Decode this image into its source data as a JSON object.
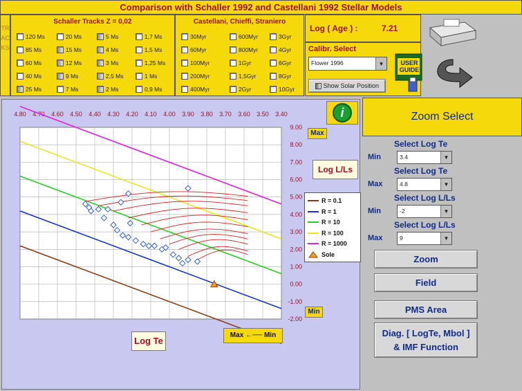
{
  "title": "Comparison with Schaller 1992 and Castellani 1992 Stellar Models",
  "tracks_label": "TRACKS",
  "schaller": {
    "title": "Schaller Tracks  Z = 0,02",
    "items": [
      "120 Ms",
      "20 Ms",
      "5 Ms",
      "1,7 Ms",
      "85 Ms",
      "15 Ms",
      "4 Ms",
      "1,5 Ms",
      "60 Ms",
      "12 Ms",
      "3 Ms",
      "1,25 Ms",
      "40 Ms",
      "9 Ms",
      "2,5 Ms",
      "1 Ms",
      "25 Ms",
      "7 Ms",
      "2 Ms",
      "0,9 Ms"
    ]
  },
  "castellani": {
    "title": "Castellani, Chieffi, Straniero",
    "items": [
      "30Myr",
      "600Myr",
      "3Gyr",
      "60Myr",
      "800Myr",
      "4Gyr",
      "100Myr",
      "1Gyr",
      "6Gyr",
      "200Myr",
      "1,5Gyr",
      "8Gyr",
      "400Myr",
      "2Gyr",
      "10Gyr"
    ]
  },
  "log_age": {
    "label": "Log ( Age ) :",
    "value": "7.21"
  },
  "calibration": {
    "label": "Calibr. Select",
    "value": "Flower 1996",
    "show_solar": "Show Solar Position"
  },
  "user_guide": "USER GUIDE",
  "zoom_select": "Zoom Select",
  "controls": [
    {
      "title": "Select Log Te",
      "side": "Min",
      "value": "3.4"
    },
    {
      "title": "Select Log Te",
      "side": "Max",
      "value": "4.8"
    },
    {
      "title": "Select Log L/Ls",
      "side": "Min",
      "value": "-2"
    },
    {
      "title": "Select Log L/Ls",
      "side": "Max",
      "value": "9"
    }
  ],
  "buttons": {
    "zoom": "Zoom",
    "field": "Field",
    "pms": "PMS Area",
    "diag": "Diag. [ LogTe, Mbol ]\n& IMF Function"
  },
  "axis_text": {
    "max": "Max",
    "min": "Min",
    "logl": "Log L/Ls",
    "logte": "Log Te",
    "te_dir": "Max ←── Min",
    "info": "i"
  },
  "legend": [
    {
      "label": "R = 0.1",
      "color": "#8b3a10"
    },
    {
      "label": "R = 1",
      "color": "#1030d0"
    },
    {
      "label": "R = 10",
      "color": "#20d020"
    },
    {
      "label": "R = 100",
      "color": "#e8e820"
    },
    {
      "label": "R = 1000",
      "color": "#e020e0"
    },
    {
      "label": "Sole",
      "color": "#f0a020"
    }
  ],
  "chart_data": {
    "type": "scatter",
    "x_ticks": [
      "4.80",
      "4.70",
      "4.60",
      "4.50",
      "4.40",
      "4.30",
      "4.20",
      "4.10",
      "4.00",
      "3.90",
      "3.80",
      "3.70",
      "3.60",
      "3.50",
      "3.40"
    ],
    "y_ticks": [
      "9.00",
      "8.00",
      "7.00",
      "6.00",
      "5.00",
      "4.00",
      "3.00",
      "2.00",
      "1.00",
      "0.00",
      "-1.00",
      "-2.00"
    ],
    "xlim": [
      4.8,
      3.4
    ],
    "ylim": [
      -2,
      9
    ],
    "radius_lines": [
      {
        "name": "R = 0.1",
        "color": "#8b3a10",
        "y_at_48": 2.2
      },
      {
        "name": "R = 1",
        "color": "#1030d0",
        "y_at_48": 4.2
      },
      {
        "name": "R = 10",
        "color": "#20d020",
        "y_at_48": 6.2
      },
      {
        "name": "R = 100",
        "color": "#e8e820",
        "y_at_48": 8.2
      },
      {
        "name": "R = 1000",
        "color": "#e020e0",
        "y_at_48": 10.2
      }
    ],
    "stars": [
      [
        4.45,
        4.6
      ],
      [
        4.43,
        4.4
      ],
      [
        4.42,
        4.2
      ],
      [
        4.38,
        4.3
      ],
      [
        4.33,
        4.3
      ],
      [
        4.35,
        3.8
      ],
      [
        4.26,
        4.7
      ],
      [
        4.22,
        5.2
      ],
      [
        3.9,
        5.5
      ],
      [
        4.3,
        3.4
      ],
      [
        4.28,
        3.1
      ],
      [
        4.25,
        2.8
      ],
      [
        4.22,
        2.7
      ],
      [
        4.18,
        2.5
      ],
      [
        4.21,
        3.5
      ],
      [
        4.14,
        2.3
      ],
      [
        4.11,
        2.2
      ],
      [
        4.08,
        2.2
      ],
      [
        4.04,
        2.0
      ],
      [
        4.02,
        2.1
      ],
      [
        3.98,
        1.7
      ],
      [
        3.95,
        1.5
      ],
      [
        3.93,
        1.2
      ],
      [
        3.9,
        1.4
      ],
      [
        3.85,
        1.3
      ]
    ],
    "sun": [
      3.76,
      0.0
    ]
  }
}
